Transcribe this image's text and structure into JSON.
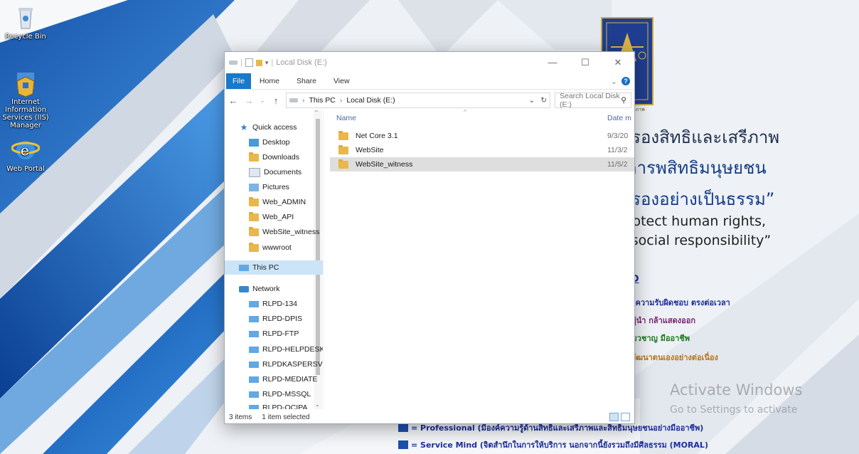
{
  "desktop": {
    "icons": [
      {
        "label": "Recycle Bin"
      },
      {
        "label": "Internet Information Services (IIS) Manager"
      },
      {
        "label": "Web Portal"
      }
    ]
  },
  "poster": {
    "logo_caption": "รองสิทธิและเสรีภาพ",
    "th_line1": "ครองสิทธิและเสรีภาพ",
    "th_line2": ".คารพสิทธิมนุษยชน",
    "th_line3": "ครองอย่างเป็นธรรม”",
    "en_line1": "protect human rights,",
    "en_line2": "e social responsibility”",
    "rlpd": "LPD",
    "line_a": "ty มีความรับผิดชอบ ตรงต่อเวลา",
    "line_b": "าวะผู้นำ กล้าแสดงออก",
    "line_c": ". เชี่ยวชาญ มืออาชีพ",
    "line_d": "nt พัฒนาตนเองอย่างต่อเนื่อง",
    "bottom1": "= Professional (มีองค์ความรู้ด้านสิทธิและเสรีภาพและสิทธิมนุษยชนอย่างมืออาชีพ)",
    "bottom2": "= Service Mind (จิตสำนึกในการให้บริการ นอกจากนี้ยังรวมถึงมีศีลธรรม (MORAL)",
    "activate_title": "Activate Windows",
    "activate_sub": "Go to Settings to activate"
  },
  "window": {
    "title": "Local Disk (E:)",
    "ribbon_tabs": [
      "File",
      "Home",
      "Share",
      "View"
    ],
    "address": {
      "parts": [
        "This PC",
        "Local Disk (E:)"
      ]
    },
    "search_placeholder": "Search Local Disk (E:)",
    "nav_items": [
      {
        "label": "Quick access",
        "icon": "star-icon",
        "pinned": false
      },
      {
        "label": "Desktop",
        "icon": "desktop-icon",
        "pinned": true
      },
      {
        "label": "Downloads",
        "icon": "downloads-icon",
        "pinned": true
      },
      {
        "label": "Documents",
        "icon": "documents-icon",
        "pinned": true
      },
      {
        "label": "Pictures",
        "icon": "pictures-icon",
        "pinned": true
      },
      {
        "label": "Web_ADMIN",
        "icon": "folder-icon",
        "pinned": false
      },
      {
        "label": "Web_API",
        "icon": "folder-icon",
        "pinned": false
      },
      {
        "label": "WebSite_witness",
        "icon": "folder-icon",
        "pinned": false
      },
      {
        "label": "wwwroot",
        "icon": "folder-icon",
        "pinned": false
      },
      {
        "label": "This PC",
        "icon": "this-pc-icon",
        "pinned": false,
        "selected": true
      },
      {
        "label": "Network",
        "icon": "network-icon",
        "pinned": false
      },
      {
        "label": "RLPD-134",
        "icon": "computer-icon"
      },
      {
        "label": "RLPD-DPIS",
        "icon": "computer-icon"
      },
      {
        "label": "RLPD-FTP",
        "icon": "computer-icon"
      },
      {
        "label": "RLPD-HELPDESK",
        "icon": "computer-icon"
      },
      {
        "label": "RLPDKASPERSV",
        "icon": "computer-icon"
      },
      {
        "label": "RLPD-MEDIATE",
        "icon": "computer-icon"
      },
      {
        "label": "RLPD-MSSQL",
        "icon": "computer-icon"
      },
      {
        "label": "RLPD-OCIPA",
        "icon": "computer-icon"
      }
    ],
    "columns": {
      "name": "Name",
      "date": "Date m"
    },
    "files": [
      {
        "name": "Net Core 3.1",
        "date": "9/3/20"
      },
      {
        "name": "WebSite",
        "date": "11/3/2"
      },
      {
        "name": "WebSite_witness",
        "date": "11/5/2",
        "selected": true
      }
    ],
    "status": {
      "count": "3 items",
      "selection": "1 item selected"
    }
  }
}
